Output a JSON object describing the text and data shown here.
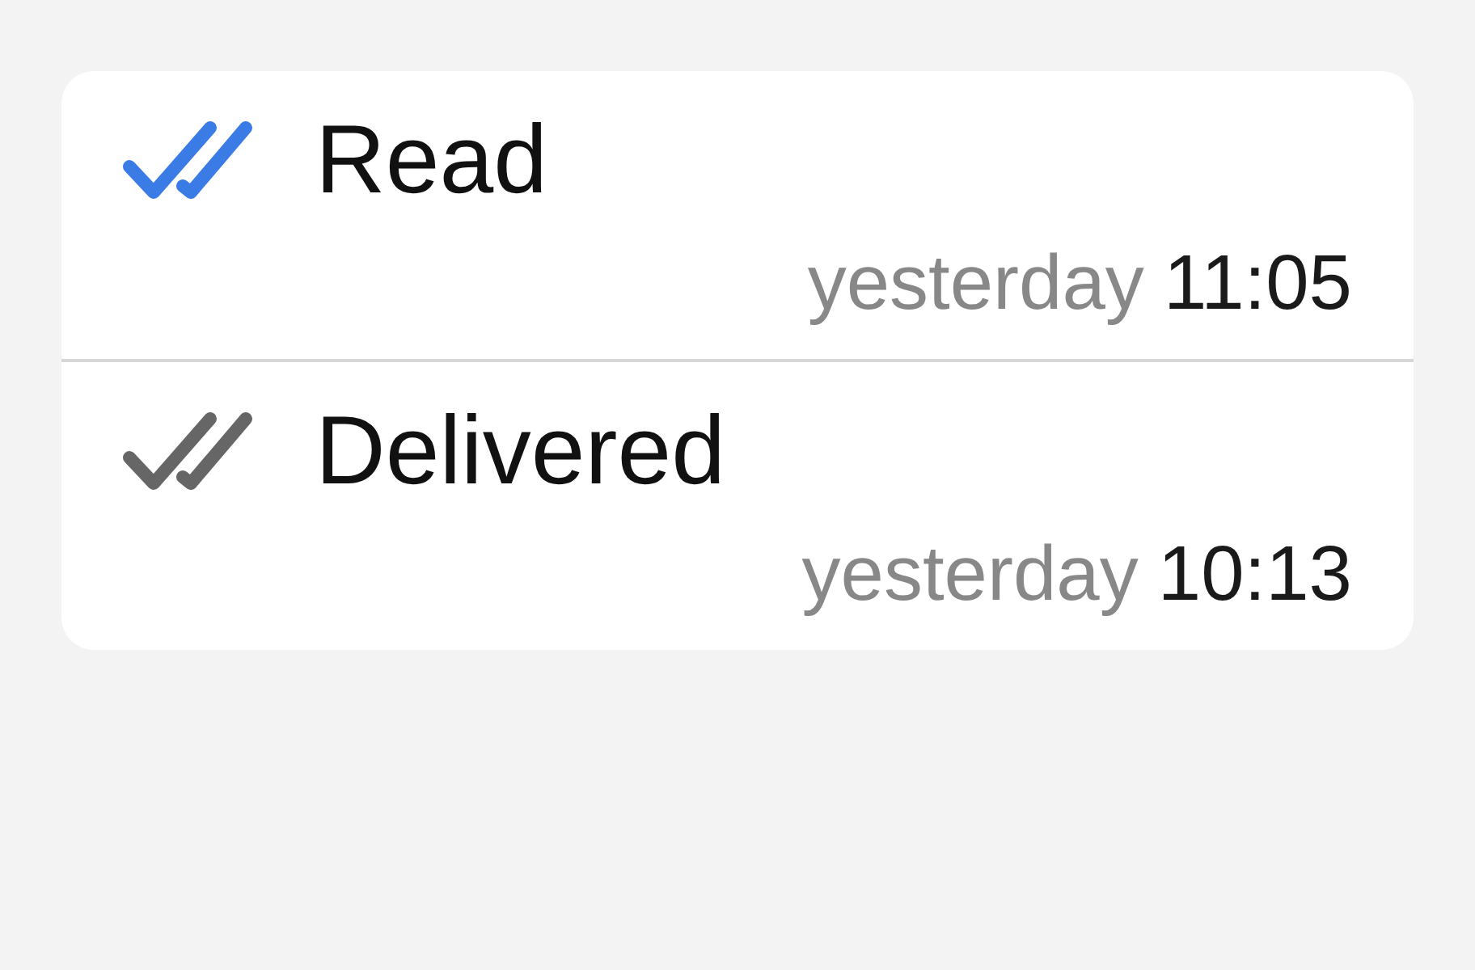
{
  "items": [
    {
      "kind": "read",
      "label": "Read",
      "day": "yesterday",
      "time": "11:05"
    },
    {
      "kind": "delivered",
      "label": "Delivered",
      "day": "yesterday",
      "time": "10:13"
    }
  ]
}
